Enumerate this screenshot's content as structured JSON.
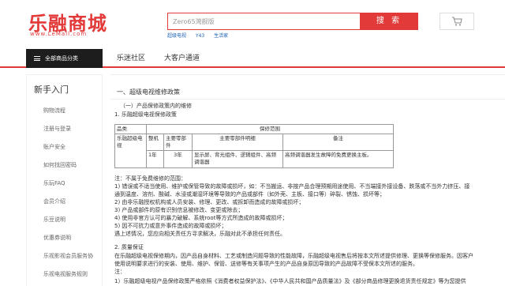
{
  "header": {
    "logo_text": "乐融商城",
    "logo_url": "www.LeMall.com",
    "search_placeholder": "Zero65灣舰版",
    "search_button": "搜 索",
    "hot_links": [
      "超级电视",
      "Y43",
      "生活家"
    ]
  },
  "nav": {
    "category_button": "全部商品分类",
    "items": [
      "乐迷社区",
      "大客户通道"
    ]
  },
  "sidebar": {
    "title": "新手入门",
    "items": [
      "购物流程",
      "注册与登录",
      "账户安全",
      "如何找回密码",
      "乐玩FAQ",
      "会员介绍",
      "乐豆说明",
      "优惠券说明",
      "乐视影视会员服务协",
      "乐视电视服务规则"
    ]
  },
  "main": {
    "section_title": "一、超级电视维修政策",
    "sub1": "（一）产品保修政策内的维修",
    "sub1_1": "1. 乐融超级电视保修政策",
    "table": {
      "head": [
        "品类",
        "保修范围"
      ],
      "subhead": [
        "整机",
        "主要零部件",
        "主要零部件明细",
        "备注"
      ],
      "row": [
        "乐融超级电视",
        "1年",
        "3年",
        "显示屏、背光组件、逻辑组件、高频调谐器",
        "高频调谐器发生故障的免费更换主板。"
      ]
    },
    "notes": [
      "注：不属于免费维修的范围：",
      "1) 错误或不适当使用、维护或保管导致的故障或损坏，如：不当搬运、非按产品合理预期用途使用、不当端接外接设备、跌落或不当外力挤压、接",
      "通到温度、溶剂、酸碱、水浸或潮湿环境等导致的产品或部件（如外壳、主板、接口等）碎裂、锈蚀、损坏等；",
      "2) 由非乐融授权机构或人员安装、修理、更改、或拆卸而造成的故障或损坏；",
      "3) 产品或部件的原有识别信息被修改、变更或除去；",
      "4) 使用非官方认可的暴力破解、系统root等方式所造成的故障或损坏；",
      "5) 因不可抗力或意外事件造成的故障或损坏；",
      "遇上述情况，您应向相关责任方寻求解决，乐融对此不承担任何责任。"
    ],
    "sub2": "2. 质量保证",
    "quality": [
      "在乐融超级电视保修期内，因产品自身材料、工艺或制造问题导致的性能故障，乐融超级电视售后将按本文所述提供修理、更换等保修服务。因客户",
      "使用说明要求进行的安装、使用、维护、保管、送修等有关事项产生的产品自身原因导致的产品故障不受保本文所述的服务。",
      "注：",
      "1）乐融超级电视产品保修政策严格依照《消费者权益保护法》、《中华人民共和国产品质量法》及《部分商品修理更换退货责任规定》等为您提供"
    ]
  }
}
